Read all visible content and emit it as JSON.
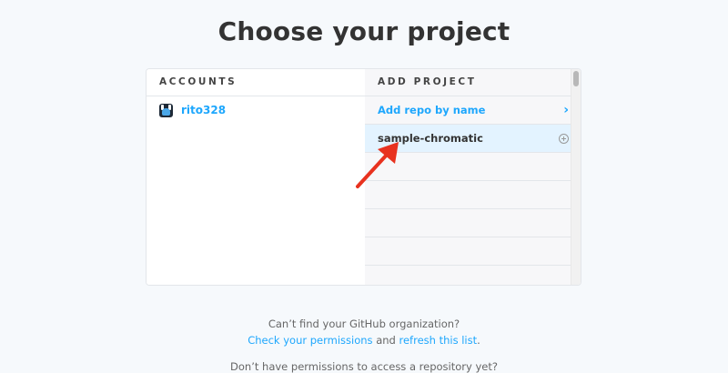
{
  "page": {
    "title": "Choose your project"
  },
  "accounts": {
    "header": "ACCOUNTS",
    "items": [
      {
        "name": "rito328",
        "avatar_icon": "robot-avatar-icon"
      }
    ]
  },
  "projects": {
    "header": "ADD PROJECT",
    "add_by_name_label": "Add repo by name",
    "add_by_name_icon": "chevron-right-icon",
    "repos": [
      {
        "name": "sample-chromatic",
        "icon": "plus-circle-icon"
      }
    ]
  },
  "footer": {
    "line1": "Can’t find your GitHub organization?",
    "check_permissions": "Check your permissions",
    "and": " and ",
    "refresh_list": "refresh this list",
    "period": ".",
    "line3": "Don’t have permissions to access a repository yet?"
  },
  "colors": {
    "accent": "#1ea7fd",
    "selected_row": "#e3f3ff",
    "annotation_arrow": "#e8321f",
    "background": "#f6f9fc"
  }
}
